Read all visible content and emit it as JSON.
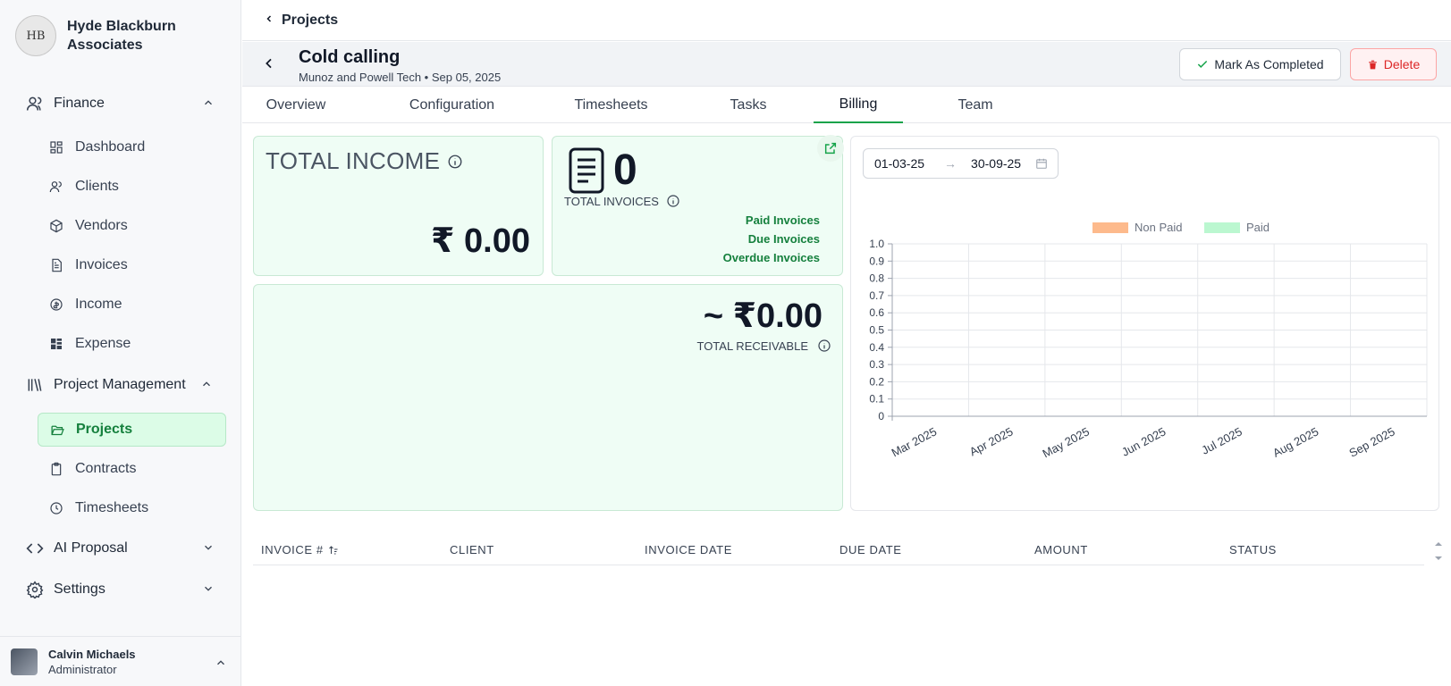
{
  "brand": {
    "logo_text": "HB",
    "name": "Hyde Blackburn Associates"
  },
  "sidebar": {
    "groups": {
      "finance": {
        "label": "Finance",
        "items": [
          "Dashboard",
          "Clients",
          "Vendors",
          "Invoices",
          "Income",
          "Expense"
        ]
      },
      "project_management": {
        "label": "Project Management",
        "items": [
          "Projects",
          "Contracts",
          "Timesheets"
        ]
      },
      "ai_proposal": {
        "label": "AI Proposal"
      },
      "settings": {
        "label": "Settings"
      }
    },
    "active_item": "Projects"
  },
  "user": {
    "name": "Calvin Michaels",
    "role": "Administrator"
  },
  "breadcrumb": {
    "label": "Projects"
  },
  "project": {
    "title": "Cold calling",
    "subtitle": "Munoz and Powell Tech • Sep 05, 2025",
    "complete_label": "Mark As Completed",
    "delete_label": "Delete"
  },
  "tabs": [
    "Overview",
    "Configuration",
    "Timesheets",
    "Tasks",
    "Billing",
    "Team"
  ],
  "active_tab": "Billing",
  "income": {
    "title": "TOTAL INCOME",
    "value": "₹ 0.00"
  },
  "invoices": {
    "count": "0",
    "label": "TOTAL INVOICES",
    "links": [
      "Paid Invoices",
      "Due Invoices",
      "Overdue Invoices"
    ]
  },
  "receivable": {
    "value": "~ ₹0.00",
    "label": "TOTAL RECEIVABLE"
  },
  "date_range": {
    "start": "01-03-25",
    "end": "30-09-25"
  },
  "chart_data": {
    "type": "bar",
    "categories": [
      "Mar 2025",
      "Apr 2025",
      "May 2025",
      "Jun 2025",
      "Jul 2025",
      "Aug 2025",
      "Sep 2025"
    ],
    "series": [
      {
        "name": "Non Paid",
        "values": [
          0,
          0,
          0,
          0,
          0,
          0,
          0
        ],
        "color": "#fdba8c"
      },
      {
        "name": "Paid",
        "values": [
          0,
          0,
          0,
          0,
          0,
          0,
          0
        ],
        "color": "#bbf7d0"
      }
    ],
    "ylim": [
      0,
      1
    ],
    "yticks": [
      "0",
      "0.1",
      "0.2",
      "0.3",
      "0.4",
      "0.5",
      "0.6",
      "0.7",
      "0.8",
      "0.9",
      "1.0"
    ],
    "grid": true,
    "legend": "top-center"
  },
  "table": {
    "columns": [
      "INVOICE #",
      "CLIENT",
      "INVOICE DATE",
      "DUE DATE",
      "AMOUNT",
      "STATUS"
    ]
  },
  "colors": {
    "accent": "#16a34a",
    "card_bg": "#effdf5",
    "danger": "#dc2626"
  }
}
